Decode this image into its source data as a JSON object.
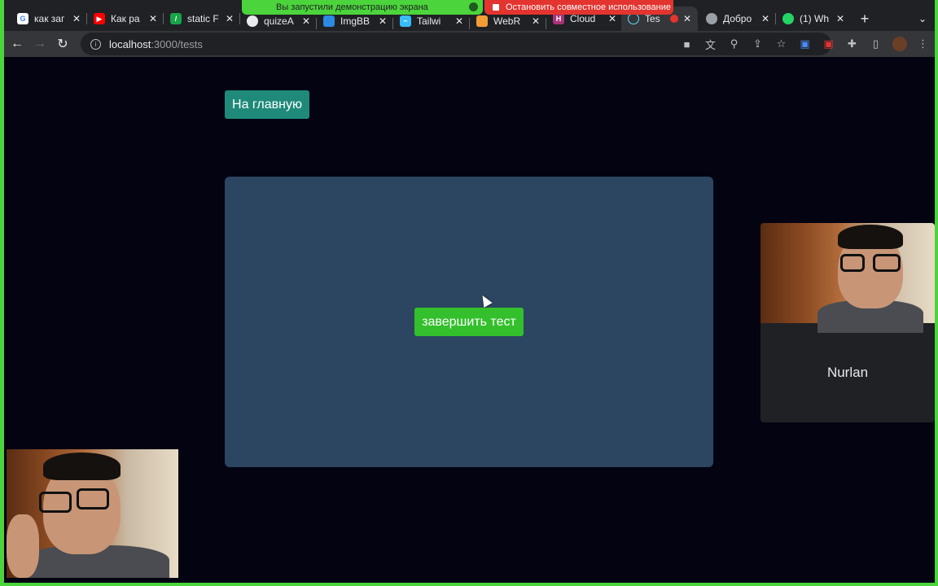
{
  "browser": {
    "tabs": [
      {
        "title": "как заг",
        "favicon": "google-icon",
        "color": "#4285f4",
        "active": false
      },
      {
        "title": "Как ра",
        "favicon": "youtube-icon",
        "color": "#ff0000",
        "active": false
      },
      {
        "title": "static F",
        "favicon": "static-site-icon",
        "color": "#17a34a",
        "active": false
      },
      {
        "title": "quizeA",
        "favicon": "github-icon",
        "color": "#e8eaed",
        "active": false
      },
      {
        "title": "ImgBB",
        "favicon": "imgbb-icon",
        "color": "#2b8ae2",
        "active": false
      },
      {
        "title": "Tailwi",
        "favicon": "tailwind-icon",
        "color": "#38bdf8",
        "active": false
      },
      {
        "title": "WebR",
        "favicon": "webrtc-icon",
        "color": "#f29d38",
        "active": false
      },
      {
        "title": "Cloud",
        "favicon": "cloud-icon",
        "color": "#a83279",
        "active": false
      },
      {
        "title": "Tes",
        "favicon": "react-icon",
        "color": "#61dafb",
        "active": true
      },
      {
        "title": "Добро",
        "favicon": "globe-icon",
        "color": "#9aa0a6",
        "active": false
      },
      {
        "title": "(1) Wh",
        "favicon": "whatsapp-icon",
        "color": "#25d366",
        "active": false
      }
    ],
    "new_tab": "+",
    "screen_share_notice": "Вы запустили демонстрацию экрана",
    "stop_share_label": "Остановить совместное использование",
    "url_host": "localhost",
    "url_path": ":3000/tests"
  },
  "page": {
    "home_button": "На главную",
    "finish_button": "завершить тест"
  },
  "video": {
    "participant_name": "Nurlan"
  }
}
